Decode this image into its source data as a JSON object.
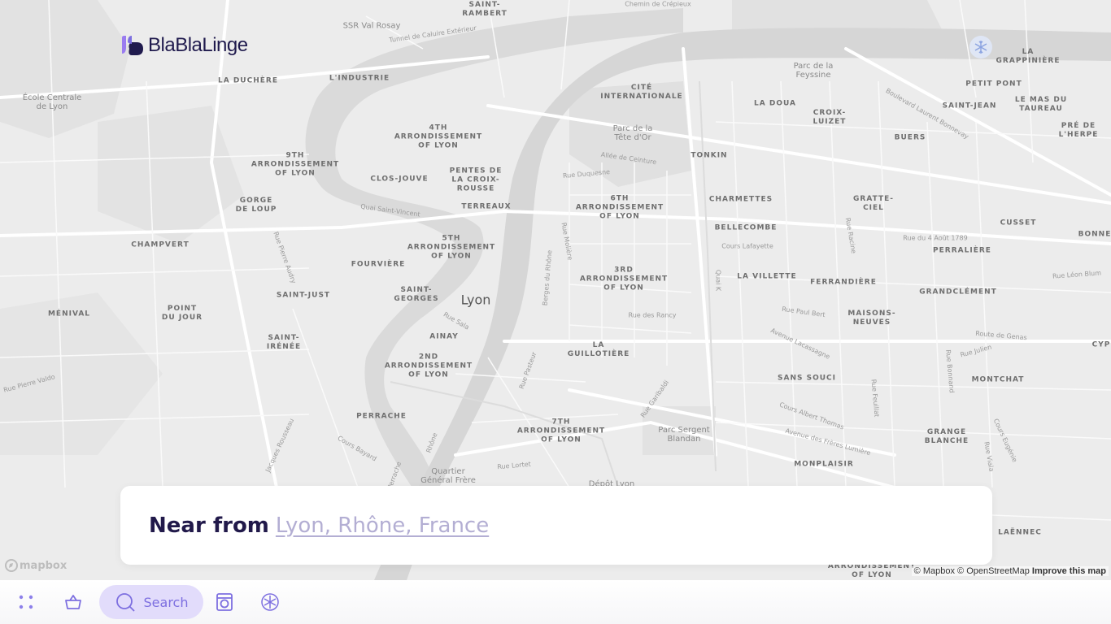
{
  "app": {
    "logo_text": "BlaBlaLinge"
  },
  "map": {
    "city_label": "Lyon",
    "districts": [
      {
        "name": "SAINT-\nRAMBERT"
      },
      {
        "name": "LA DUCHÈRE"
      },
      {
        "name": "L'INDUSTRIE"
      },
      {
        "name": "CITÉ\nINTERNATIONALE"
      },
      {
        "name": "LA DOUA"
      },
      {
        "name": "CROIX-\nLUIZET"
      },
      {
        "name": "BUERS"
      },
      {
        "name": "LA\nGRAPPINIÈRE"
      },
      {
        "name": "PETIT PONT"
      },
      {
        "name": "SAINT-JEAN"
      },
      {
        "name": "LE MAS DU\nTAUREAU"
      },
      {
        "name": "PRÉ DE\nL'HERPE"
      },
      {
        "name": "4TH\nARRONDISSEMENT\nOF LYON"
      },
      {
        "name": "9TH\nARRONDISSEMENT\nOF LYON"
      },
      {
        "name": "CLOS-JOUVE"
      },
      {
        "name": "PENTES DE\nLA CROIX-\nROUSSE"
      },
      {
        "name": "TONKIN"
      },
      {
        "name": "GORGE\nDE LOUP"
      },
      {
        "name": "TERREAUX"
      },
      {
        "name": "6TH\nARRONDISSEMENT\nOF LYON"
      },
      {
        "name": "CHARMETTES"
      },
      {
        "name": "GRATTE-\nCIEL"
      },
      {
        "name": "BELLECOMBE"
      },
      {
        "name": "CUSSET"
      },
      {
        "name": "BONNE"
      },
      {
        "name": "CHAMPVERT"
      },
      {
        "name": "5TH\nARRONDISSEMENT\nOF LYON"
      },
      {
        "name": "PERRALIÈRE"
      },
      {
        "name": "FOURVIÈRE"
      },
      {
        "name": "3RD\nARRONDISSEMENT\nOF LYON"
      },
      {
        "name": "LA VILLETTE"
      },
      {
        "name": "FERRANDIÈRE"
      },
      {
        "name": "SAINT-JUST"
      },
      {
        "name": "SAINT-\nGEORGES"
      },
      {
        "name": "GRANDCLÉMENT"
      },
      {
        "name": "MÉNIVAL"
      },
      {
        "name": "POINT\nDU JOUR"
      },
      {
        "name": "MAISONS-\nNEUVES"
      },
      {
        "name": "AINAY"
      },
      {
        "name": "SAINT-\nIRÉNÉE"
      },
      {
        "name": "LA\nGUILLOTIÈRE"
      },
      {
        "name": "2ND\nARRONDISSEMENT\nOF LYON"
      },
      {
        "name": "SANS SOUCI"
      },
      {
        "name": "MONTCHAT"
      },
      {
        "name": "PERRACHE"
      },
      {
        "name": "7TH\nARRONDISSEMENT\nOF LYON"
      },
      {
        "name": "GRANGE\nBLANCHE"
      },
      {
        "name": "MONPLAISIR"
      },
      {
        "name": "LAËNNEC"
      },
      {
        "name": "ARRONDISSEMENT\nOF LYON"
      },
      {
        "name": "CYP"
      }
    ],
    "pois": [
      {
        "name": "SSR Val Rosay"
      },
      {
        "name": "École Centrale\nde Lyon"
      },
      {
        "name": "Parc de la\nFeyssine"
      },
      {
        "name": "Parc de la\nTête d'Or"
      },
      {
        "name": "Parc Sergent\nBlandan"
      },
      {
        "name": "Quartier\nGénéral Frère"
      },
      {
        "name": "Dépôt Lyon"
      }
    ],
    "streets": [
      {
        "name": "Chemin de Crépieux"
      },
      {
        "name": "Tunnel de Caluire Extérieur"
      },
      {
        "name": "Quai Saint-Vincent"
      },
      {
        "name": "Rue Duquesne"
      },
      {
        "name": "Allée de Ceinture"
      },
      {
        "name": "Cours Lafayette"
      },
      {
        "name": "Rue du 4 Août 1789"
      },
      {
        "name": "Rue Léon Blum"
      },
      {
        "name": "Rue Paul Bert"
      },
      {
        "name": "Avenue Lacassagne"
      },
      {
        "name": "Route de Genas"
      },
      {
        "name": "Rue Julien"
      },
      {
        "name": "Rue des Rancy"
      },
      {
        "name": "Rue Sala"
      },
      {
        "name": "Rue Pasteur"
      },
      {
        "name": "Rue Garibaldi"
      },
      {
        "name": "Cours Albert Thomas"
      },
      {
        "name": "Avenue des Frères Lumière"
      },
      {
        "name": "Cours Bayard"
      },
      {
        "name": "Rue Lortet"
      },
      {
        "name": "Rhône"
      },
      {
        "name": "Rue Pierre Valdo"
      },
      {
        "name": "Quai K"
      },
      {
        "name": "Rue Molière"
      },
      {
        "name": "Berges du Rhône"
      },
      {
        "name": "Rue Feuillat"
      },
      {
        "name": "Rue Bonnand"
      },
      {
        "name": "Cours Eugénie"
      },
      {
        "name": "Rue Viala"
      },
      {
        "name": "Rue Racine"
      },
      {
        "name": "Boulevard Laurent Bonnevay"
      },
      {
        "name": "Rue Pierre Audry"
      },
      {
        "name": "Jacques Rousseau"
      },
      {
        "name": "Perrache"
      }
    ],
    "attribution": {
      "mapbox": "© Mapbox",
      "osm": "© OpenStreetMap",
      "improve": "Improve this map"
    },
    "mapbox_logo_text": "mapbox"
  },
  "location_card": {
    "prefix": "Near from",
    "location": "Lyon, Rhône, France"
  },
  "bottom_nav": {
    "items": [
      {
        "icon": "grid-dots-icon"
      },
      {
        "icon": "basket-icon"
      },
      {
        "icon": "search-icon",
        "label": "Search"
      },
      {
        "icon": "washing-machine-icon"
      },
      {
        "icon": "snowflake-icon"
      }
    ]
  },
  "colors": {
    "brand_dark": "#1f1a4d",
    "brand_purple": "#7d6fe0",
    "search_pill": "#e2dcfb",
    "location_link": "#b3aed3"
  }
}
